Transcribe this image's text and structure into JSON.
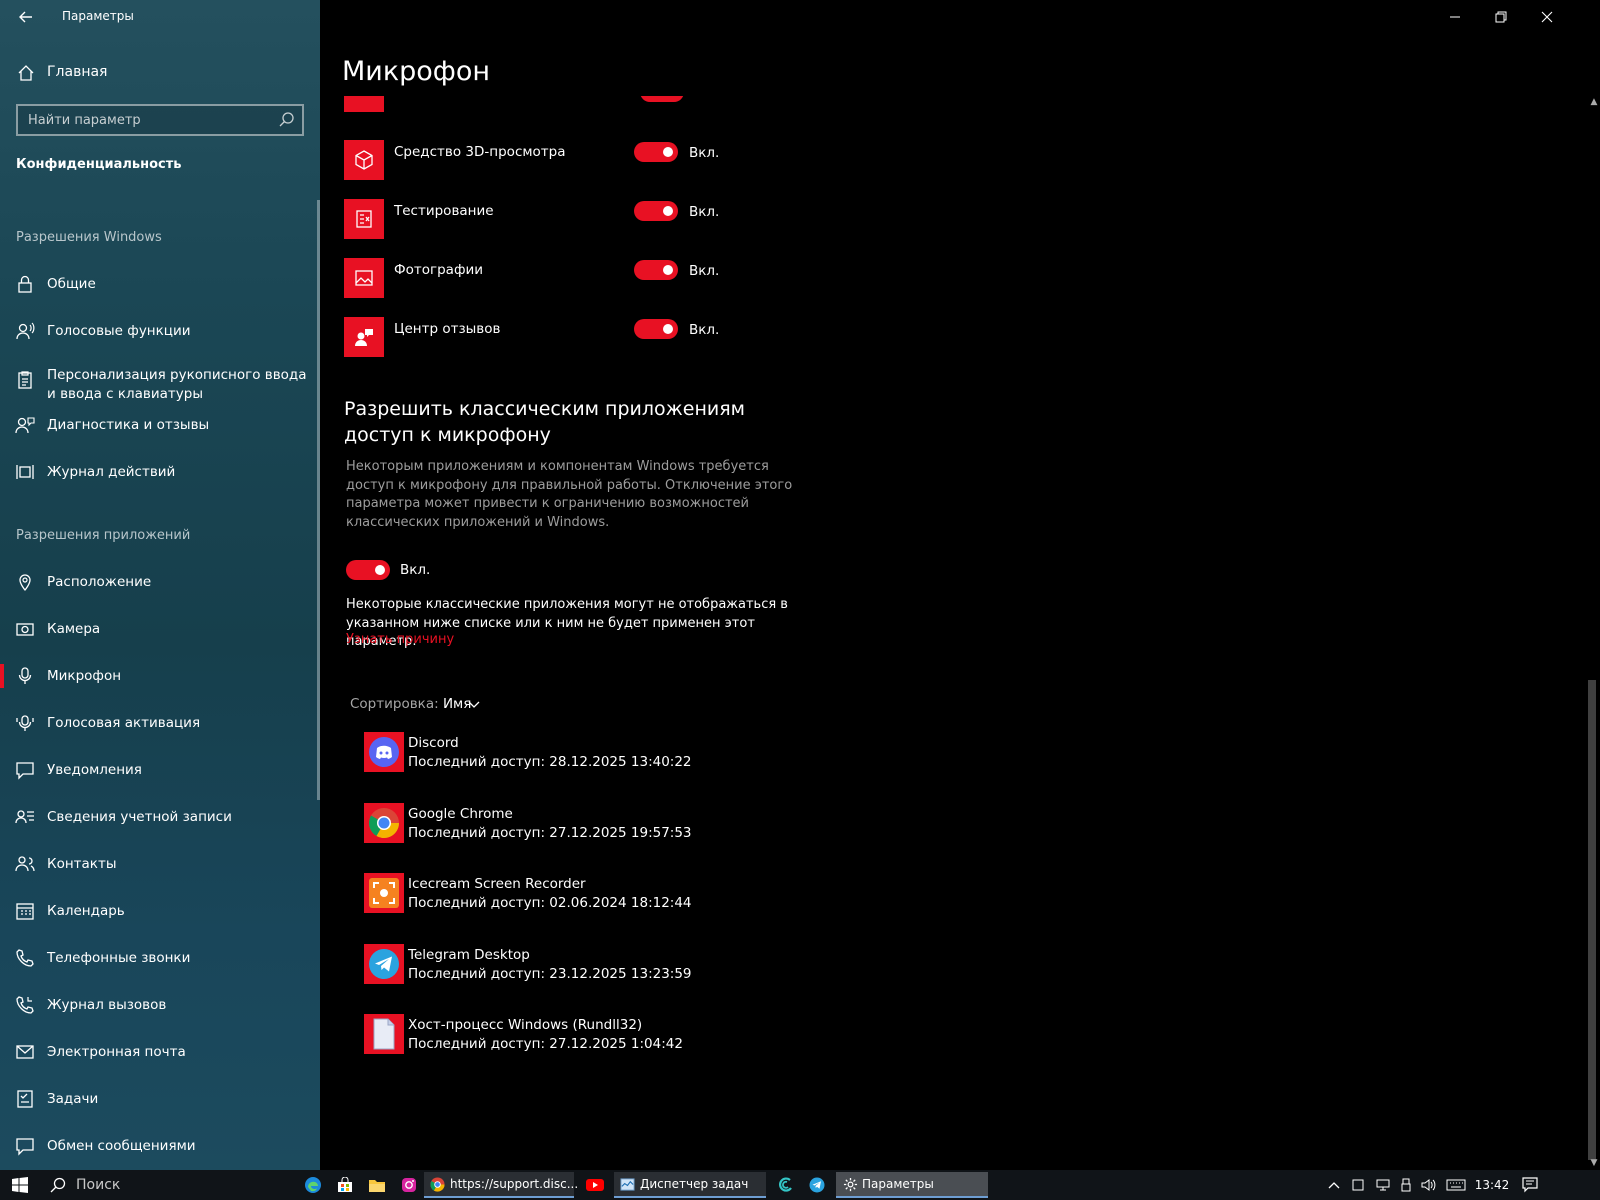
{
  "window": {
    "app_title": "Параметры",
    "page_title": "Микрофон"
  },
  "sidebar": {
    "home_label": "Главная",
    "search_placeholder": "Найти параметр",
    "category_title": "Конфиденциальность",
    "windows_permissions_header": "Разрешения Windows",
    "app_permissions_header": "Разрешения приложений",
    "windows_items": [
      {
        "label": "Общие",
        "icon": "lock-icon"
      },
      {
        "label": "Голосовые функции",
        "icon": "speech-icon"
      },
      {
        "label": "Персонализация рукописного ввода и ввода с клавиатуры",
        "icon": "clipboard-icon"
      },
      {
        "label": "Диагностика и отзывы",
        "icon": "feedback-person-icon"
      },
      {
        "label": "Журнал действий",
        "icon": "activity-history-icon"
      }
    ],
    "app_items": [
      {
        "label": "Расположение",
        "icon": "location-icon"
      },
      {
        "label": "Камера",
        "icon": "camera-icon"
      },
      {
        "label": "Микрофон",
        "icon": "microphone-icon",
        "selected": true
      },
      {
        "label": "Голосовая активация",
        "icon": "voice-activation-icon"
      },
      {
        "label": "Уведомления",
        "icon": "notification-icon"
      },
      {
        "label": "Сведения учетной записи",
        "icon": "account-info-icon"
      },
      {
        "label": "Контакты",
        "icon": "contacts-icon"
      },
      {
        "label": "Календарь",
        "icon": "calendar-icon"
      },
      {
        "label": "Телефонные звонки",
        "icon": "phone-icon"
      },
      {
        "label": "Журнал вызовов",
        "icon": "call-history-icon"
      },
      {
        "label": "Электронная почта",
        "icon": "mail-icon"
      },
      {
        "label": "Задачи",
        "icon": "tasks-icon"
      },
      {
        "label": "Обмен сообщениями",
        "icon": "messaging-icon"
      }
    ]
  },
  "store_apps": [
    {
      "name": "Средство 3D-просмотра",
      "state": "Вкл.",
      "on": true,
      "icon": "cube-icon"
    },
    {
      "name": "Тестирование",
      "state": "Вкл.",
      "on": true,
      "icon": "test-icon"
    },
    {
      "name": "Фотографии",
      "state": "Вкл.",
      "on": true,
      "icon": "photo-icon"
    },
    {
      "name": "Центр отзывов",
      "state": "Вкл.",
      "on": true,
      "icon": "feedback-hub-icon"
    }
  ],
  "classic_section": {
    "heading": "Разрешить классическим приложениям доступ к микрофону",
    "description": "Некоторым приложениям и компонентам Windows требуется доступ к микрофону для правильной работы. Отключение этого параметра может привести к ограничению возможностей классических приложений и Windows.",
    "toggle_state": "Вкл.",
    "note": "Некоторые классические приложения могут не отображаться в указанном ниже списке или к ним не будет применен этот параметр.",
    "link": "Узнать причину",
    "sort_label": "Сортировка:",
    "sort_value": "Имя"
  },
  "classic_apps": [
    {
      "name": "Discord",
      "last_access": "Последний доступ: 28.12.2025 13:40:22",
      "icon": "discord-icon"
    },
    {
      "name": "Google Chrome",
      "last_access": "Последний доступ: 27.12.2025 19:57:53",
      "icon": "chrome-icon"
    },
    {
      "name": "Icecream Screen Recorder",
      "last_access": "Последний доступ: 02.06.2024 18:12:44",
      "icon": "icecream-icon"
    },
    {
      "name": "Telegram Desktop",
      "last_access": "Последний доступ: 23.12.2025 13:23:59",
      "icon": "telegram-icon"
    },
    {
      "name": "Хост-процесс Windows (Rundll32)",
      "last_access": "Последний доступ: 27.12.2025 1:04:42",
      "icon": "file-icon"
    }
  ],
  "taskbar": {
    "search_label": "Поиск",
    "tasks": [
      {
        "label": "https://support.disc...",
        "icon": "chrome-icon"
      },
      {
        "label": "Диспетчер задач",
        "icon": "task-manager-icon"
      },
      {
        "label": "Параметры",
        "icon": "settings-gear-icon"
      }
    ],
    "clock": "13:42"
  },
  "colors": {
    "accent": "#e81123",
    "sidebar_bg": "#1b4755",
    "main_bg": "#000000",
    "muted_text": "#9d9d9d"
  }
}
